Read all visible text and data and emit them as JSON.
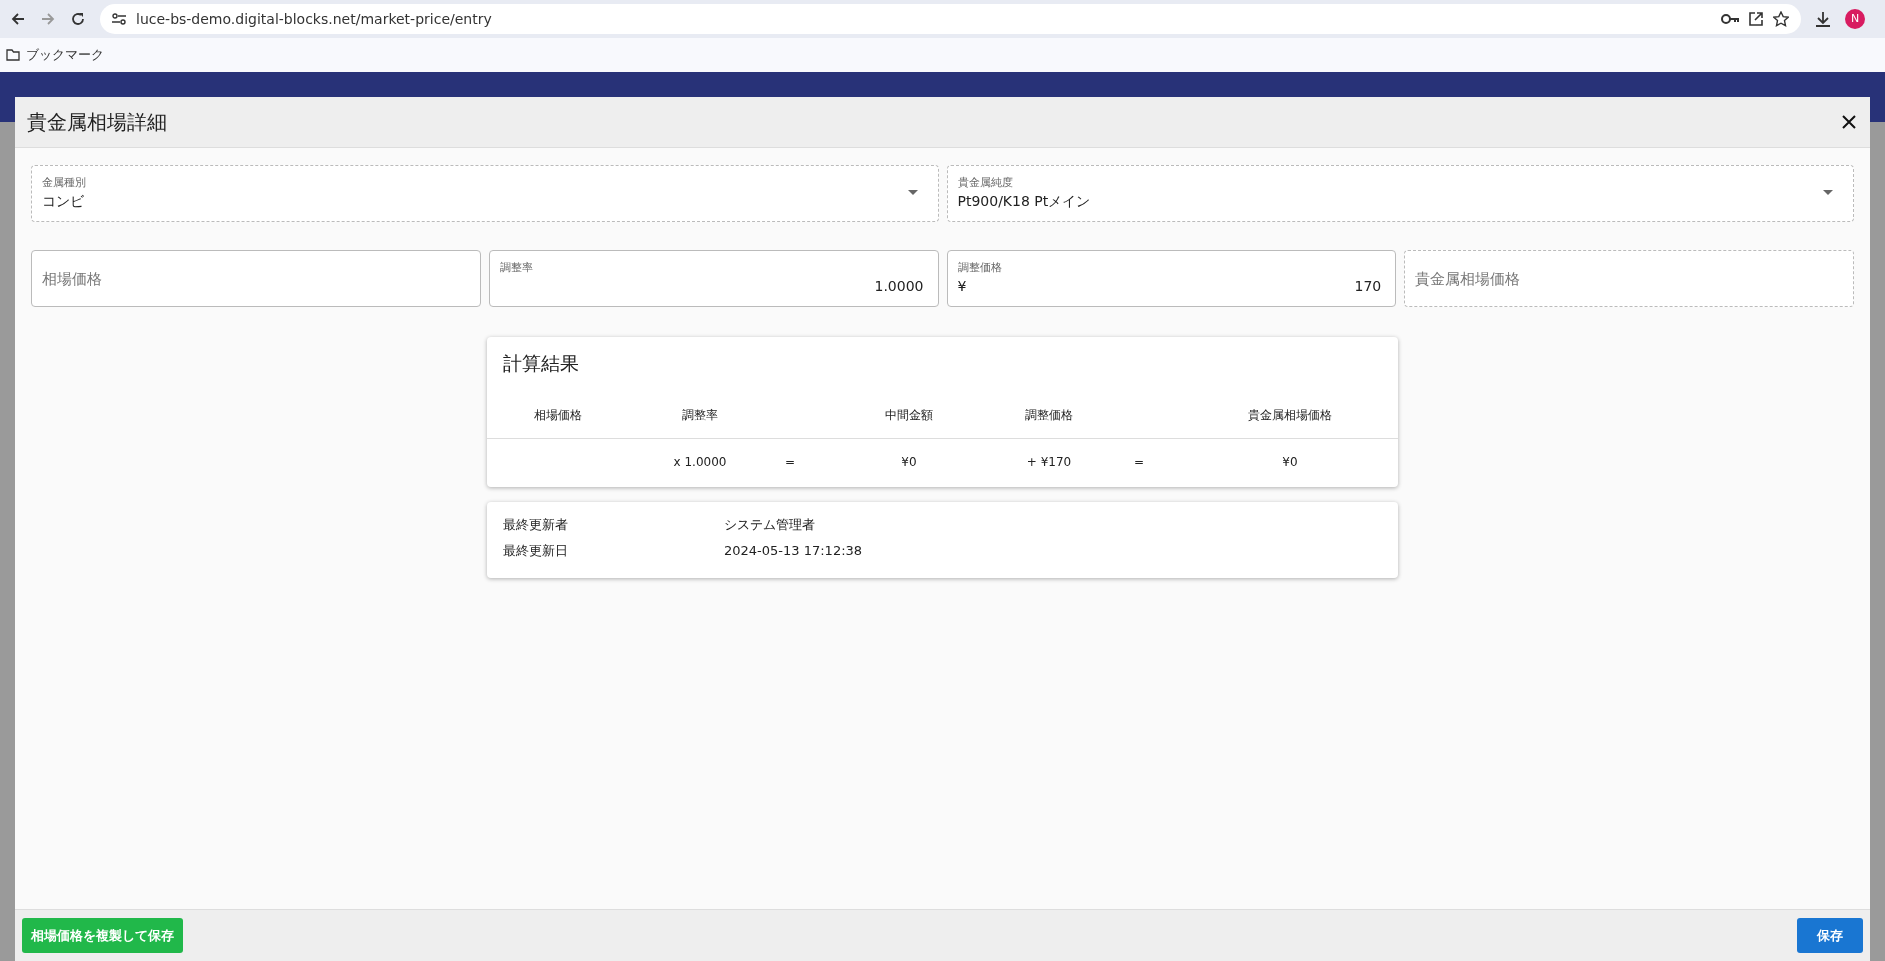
{
  "browser": {
    "url": "luce-bs-demo.digital-blocks.net/market-price/entry",
    "bookmarks_label": "ブックマーク",
    "profile_initial": "N"
  },
  "dialog": {
    "title": "貴金属相場詳細",
    "selects": [
      {
        "label": "金属種別",
        "value": "コンビ",
        "readonly": true
      },
      {
        "label": "貴金属純度",
        "value": "Pt900/K18 Ptメイン",
        "readonly": true
      }
    ],
    "fields": [
      {
        "placeholder": "相場価格",
        "readonly": false
      },
      {
        "label": "調整率",
        "value": "1.0000",
        "readonly": false
      },
      {
        "label": "調整価格",
        "prefix": "¥",
        "value": "170",
        "readonly": false
      },
      {
        "placeholder": "貴金属相場価格",
        "readonly": true
      }
    ],
    "calculation": {
      "title": "計算結果",
      "columns": [
        {
          "header": "相場価格"
        },
        {
          "header": "調整率",
          "value": "x 1.0000"
        },
        {
          "value": "="
        },
        {
          "header": "中間金額",
          "value": "¥0"
        },
        {
          "header": "調整価格",
          "value": "+ ¥170"
        },
        {
          "value": "="
        },
        {
          "header": "貴金属相場価格",
          "value": "¥0"
        }
      ]
    },
    "audit": [
      {
        "label": "最終更新者",
        "value": "システム管理者"
      },
      {
        "label": "最終更新日",
        "value": "2024-05-13 17:12:38"
      }
    ],
    "buttons": [
      {
        "label": "相場価格を複製して保存",
        "kind": "success"
      },
      {
        "label": "保存",
        "kind": "primary"
      }
    ]
  }
}
